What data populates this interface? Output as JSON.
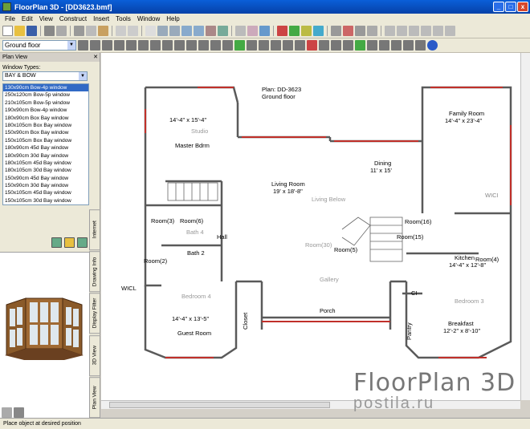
{
  "window": {
    "title": "FloorPlan 3D - [DD3623.bmf]",
    "min": "_",
    "max": "□",
    "close": "x"
  },
  "menu": [
    "File",
    "Edit",
    "View",
    "Construct",
    "Insert",
    "Tools",
    "Window",
    "Help"
  ],
  "floor_selector": {
    "value": "Ground floor"
  },
  "panel": {
    "title": "Plan View",
    "window_types_label": "Window Types:",
    "window_type_value": "BAY & BOW",
    "window_list": [
      "130x90cm Bow-4p window",
      "250x120cm Bow-5p window",
      "210x105cm Bow-5p window",
      "190x90cm Bow-4p window",
      "180x90cm Box Bay window",
      "180x105cm Box Bay window",
      "150x90cm Box Bay window",
      "150x105cm Box Bay window",
      "180x90cm 45d Bay window",
      "180x90cm 30d Bay window",
      "180x105cm 45d Bay window",
      "180x105cm 30d Bay window",
      "150x90cm 45d Bay window",
      "150x90cm 30d Bay window",
      "150x105cm 45d Bay window",
      "150x105cm 30d Bay window"
    ],
    "selected_index": 0,
    "side_tabs": [
      "Internet",
      "Drawing Info",
      "Display Filter",
      "3D View",
      "Plan View"
    ]
  },
  "plan": {
    "title_line1": "Plan: DD-3623",
    "title_line2": "Ground floor",
    "rooms": [
      {
        "name": "Master Bdrm",
        "dim": "14'-4\" x 15'-4\""
      },
      {
        "name": "Family Room",
        "dim": "14'-4\" x 23'-4\""
      },
      {
        "name": "Dining",
        "dim": "11' x 15'"
      },
      {
        "name": "Living Room",
        "dim": "19' x 18'-8\""
      },
      {
        "name": "Kitchen",
        "dim": "14'-4\" x 12'-8\""
      },
      {
        "name": "Breakfast",
        "dim": "12'-2\" x 8'-10\""
      },
      {
        "name": "Guest Room",
        "dim": "14'-4\" x 13'-5\""
      }
    ],
    "labels": [
      "Room(3)",
      "Room(2)",
      "Bath 2",
      "Hall",
      "WICL",
      "Closet",
      "Porch",
      "Pantry",
      "CI",
      "WICI",
      "Room(16)",
      "Room(15)",
      "Room(4)",
      "Room(5)",
      "Room(6)",
      "Room(30)",
      "Living Below",
      "Gallery",
      "Studio",
      "Bedroom 4",
      "Bath 4",
      "Bedroom 3"
    ]
  },
  "status": "Place object at desired position",
  "watermark": {
    "line1": "FloorPlan 3D",
    "line2": "postila.ru"
  },
  "colors": {
    "titlebar": "#0a5fd8",
    "selection": "#316ac5",
    "wall": "#5a5a5a",
    "window": "#c0302a"
  }
}
